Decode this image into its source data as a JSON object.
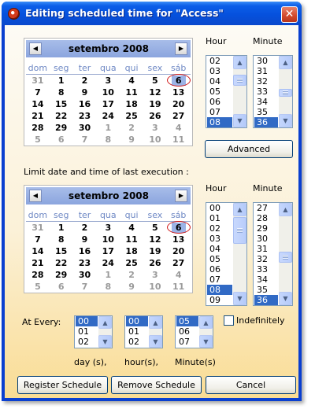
{
  "window": {
    "title": "Editing scheduled time for \"Access\"",
    "close": "✕"
  },
  "calendar1": {
    "month_title": "setembro 2008",
    "prev": "◀",
    "next": "▶",
    "weekdays": [
      "dom",
      "seg",
      "ter",
      "qua",
      "qui",
      "sex",
      "sáb"
    ],
    "weeks": [
      [
        "31",
        "1",
        "2",
        "3",
        "4",
        "5",
        "6"
      ],
      [
        "7",
        "8",
        "9",
        "10",
        "11",
        "12",
        "13"
      ],
      [
        "14",
        "15",
        "16",
        "17",
        "18",
        "19",
        "20"
      ],
      [
        "21",
        "22",
        "23",
        "24",
        "25",
        "26",
        "27"
      ],
      [
        "28",
        "29",
        "30",
        "1",
        "2",
        "3",
        "4"
      ],
      [
        "5",
        "6",
        "7",
        "8",
        "9",
        "10",
        "11"
      ]
    ]
  },
  "calendar2": {
    "month_title": "setembro 2008",
    "prev": "◀",
    "next": "▶",
    "weekdays": [
      "dom",
      "seg",
      "ter",
      "qua",
      "qui",
      "sex",
      "sáb"
    ],
    "weeks": [
      [
        "31",
        "1",
        "2",
        "3",
        "4",
        "5",
        "6"
      ],
      [
        "7",
        "8",
        "9",
        "10",
        "11",
        "12",
        "13"
      ],
      [
        "14",
        "15",
        "16",
        "17",
        "18",
        "19",
        "20"
      ],
      [
        "21",
        "22",
        "23",
        "24",
        "25",
        "26",
        "27"
      ],
      [
        "28",
        "29",
        "30",
        "1",
        "2",
        "3",
        "4"
      ],
      [
        "5",
        "6",
        "7",
        "8",
        "9",
        "10",
        "11"
      ]
    ]
  },
  "schedule": {
    "hour_label": "Hour",
    "minute_label": "Minute",
    "hours": [
      "02",
      "03",
      "04",
      "05",
      "06",
      "07",
      "08"
    ],
    "hour_selected": "08",
    "minutes": [
      "30",
      "31",
      "32",
      "33",
      "34",
      "35",
      "36"
    ],
    "minute_selected": "36",
    "advanced_label": "Advanced"
  },
  "limit": {
    "label": "Limit date and time of last execution :",
    "hour_label": "Hour",
    "minute_label": "Minute",
    "hours": [
      "00",
      "01",
      "02",
      "03",
      "04",
      "05",
      "06",
      "07",
      "08",
      "09"
    ],
    "hour_selected": "08",
    "minutes": [
      "27",
      "28",
      "29",
      "30",
      "31",
      "32",
      "33",
      "34",
      "35",
      "36"
    ],
    "minute_selected": "36"
  },
  "repeat": {
    "at_every_label": "At Every:",
    "days": [
      "00",
      "01",
      "02"
    ],
    "days_selected": "00",
    "days_unit": "day (s),",
    "hours": [
      "00",
      "01",
      "02"
    ],
    "hours_selected": "00",
    "hours_unit": "hour(s),",
    "minutes": [
      "05",
      "06",
      "07"
    ],
    "minutes_selected": "05",
    "minutes_unit": "Minute(s)",
    "indefinitely_label": "Indefinitely",
    "indefinitely_checked": false
  },
  "buttons": {
    "register": "Register Schedule",
    "remove": "Remove Schedule",
    "cancel": "Cancel"
  },
  "icons": {
    "scroll_up": "▲",
    "scroll_down": "▼"
  },
  "colors": {
    "titlebar": "#0a49cc",
    "selection": "#316ac5",
    "today_marker": "#d01818",
    "weekday_text": "#6e88c4"
  }
}
